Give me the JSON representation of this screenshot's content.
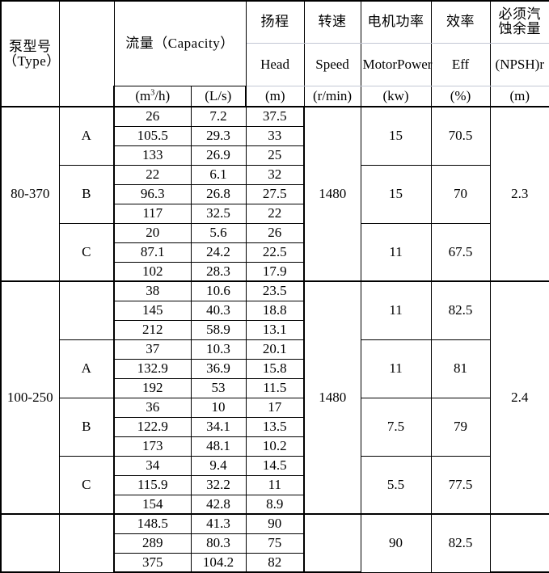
{
  "table": {
    "columns": [
      {
        "id": "type",
        "cn": "泵型号（Type）",
        "en": "",
        "unit": ""
      },
      {
        "id": "grp",
        "cn": "",
        "en": "",
        "unit": ""
      },
      {
        "id": "cap",
        "cn": "流量（Capacity）",
        "en": "",
        "unit_m3h": "(m",
        "unit_m3h_exp": "3",
        "unit_m3h_tail": "/h)",
        "unit_ls": "(L/s)"
      },
      {
        "id": "head",
        "cn": "扬程",
        "en": "Head",
        "unit": "(m)"
      },
      {
        "id": "speed",
        "cn": "转速",
        "en": "Speed",
        "unit": "(r/min)"
      },
      {
        "id": "power",
        "cn": "电机功率",
        "en": "Motor Power",
        "en_line1": "Motor",
        "en_line2": "Power",
        "unit": "(kw)"
      },
      {
        "id": "eff",
        "cn": "效率",
        "en": "Eff",
        "unit": "(%)"
      },
      {
        "id": "npsh",
        "cn": "必须汽蚀余量",
        "cn_line1": "必须汽",
        "cn_line2": "蚀余量",
        "en": "(NPSH)r",
        "unit": "(m)"
      }
    ],
    "blocks": [
      {
        "type": "80-370",
        "speed": "1480",
        "npsh": "2.3",
        "groups": [
          {
            "letter": "A",
            "power": "15",
            "eff": "70.5",
            "rows": [
              {
                "m3h": "26",
                "ls": "7.2",
                "head": "37.5"
              },
              {
                "m3h": "105.5",
                "ls": "29.3",
                "head": "33"
              },
              {
                "m3h": "133",
                "ls": "26.9",
                "head": "25"
              }
            ]
          },
          {
            "letter": "B",
            "power": "15",
            "eff": "70",
            "rows": [
              {
                "m3h": "22",
                "ls": "6.1",
                "head": "32"
              },
              {
                "m3h": "96.3",
                "ls": "26.8",
                "head": "27.5"
              },
              {
                "m3h": "117",
                "ls": "32.5",
                "head": "22"
              }
            ]
          },
          {
            "letter": "C",
            "power": "11",
            "eff": "67.5",
            "rows": [
              {
                "m3h": "20",
                "ls": "5.6",
                "head": "26"
              },
              {
                "m3h": "87.1",
                "ls": "24.2",
                "head": "22.5"
              },
              {
                "m3h": "102",
                "ls": "28.3",
                "head": "17.9"
              }
            ]
          }
        ]
      },
      {
        "type": "100-250",
        "speed": "1480",
        "npsh": "2.4",
        "groups": [
          {
            "letter": "",
            "power": "11",
            "eff": "82.5",
            "rows": [
              {
                "m3h": "38",
                "ls": "10.6",
                "head": "23.5"
              },
              {
                "m3h": "145",
                "ls": "40.3",
                "head": "18.8"
              },
              {
                "m3h": "212",
                "ls": "58.9",
                "head": "13.1"
              }
            ]
          },
          {
            "letter": "A",
            "power": "11",
            "eff": "81",
            "rows": [
              {
                "m3h": "37",
                "ls": "10.3",
                "head": "20.1"
              },
              {
                "m3h": "132.9",
                "ls": "36.9",
                "head": "15.8"
              },
              {
                "m3h": "192",
                "ls": "53",
                "head": "11.5"
              }
            ]
          },
          {
            "letter": "B",
            "power": "7.5",
            "eff": "79",
            "rows": [
              {
                "m3h": "36",
                "ls": "10",
                "head": "17"
              },
              {
                "m3h": "122.9",
                "ls": "34.1",
                "head": "13.5"
              },
              {
                "m3h": "173",
                "ls": "48.1",
                "head": "10.2"
              }
            ]
          },
          {
            "letter": "C",
            "power": "5.5",
            "eff": "77.5",
            "rows": [
              {
                "m3h": "34",
                "ls": "9.4",
                "head": "14.5"
              },
              {
                "m3h": "115.9",
                "ls": "32.2",
                "head": "11"
              },
              {
                "m3h": "154",
                "ls": "42.8",
                "head": "8.9"
              }
            ]
          }
        ]
      },
      {
        "type": "",
        "speed": "",
        "npsh": "",
        "groups": [
          {
            "letter": "",
            "power": "90",
            "eff": "82.5",
            "rows": [
              {
                "m3h": "148.5",
                "ls": "41.3",
                "head": "90"
              },
              {
                "m3h": "289",
                "ls": "80.3",
                "head": "75"
              },
              {
                "m3h": "375",
                "ls": "104.2",
                "head": "82"
              }
            ]
          }
        ]
      }
    ]
  },
  "colors": {
    "grid": "#000000",
    "grid_light": "#c3c7d4",
    "background": "#ffffff",
    "text": "#000000"
  }
}
